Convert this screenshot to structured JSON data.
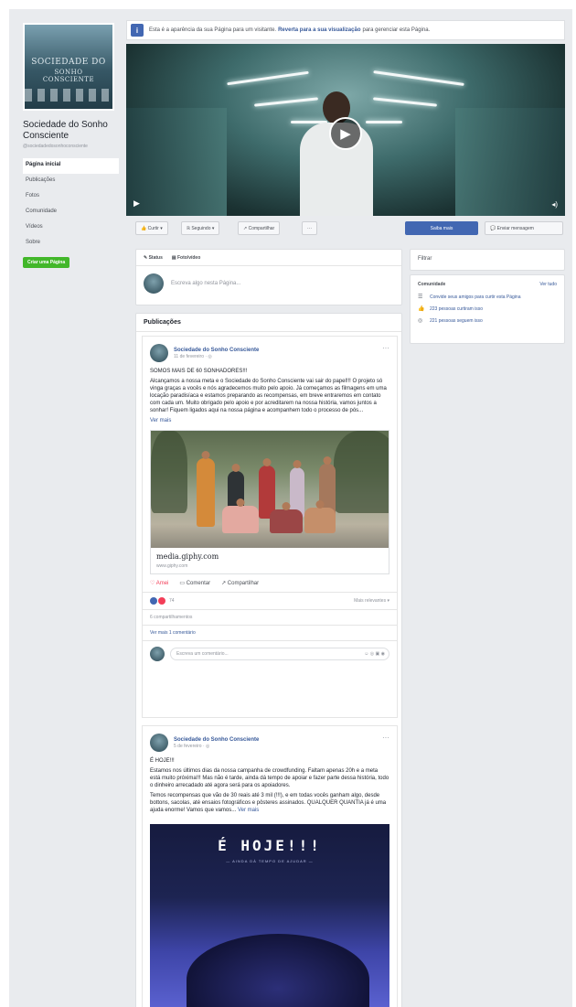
{
  "page": {
    "cover_line1": "SOCIEDADE DO",
    "cover_line2": "SONHO CONSCIENTE",
    "name": "Sociedade do Sonho Consciente",
    "username": "@sociedadedosonhoconsciente",
    "create_page": "Criar uma Página"
  },
  "nav": [
    {
      "label": "Página inicial",
      "active": true
    },
    {
      "label": "Publicações"
    },
    {
      "label": "Fotos"
    },
    {
      "label": "Comunidade"
    },
    {
      "label": "Vídeos"
    },
    {
      "label": "Sobre"
    }
  ],
  "banner": {
    "icon": "i",
    "text_before": "Esta é a aparência da sua Página para um visitante.",
    "link": "Reverta para a sua visualização",
    "text_after": "para gerenciar esta Página."
  },
  "actions": {
    "like": "👍 Curtir ▾",
    "follow": "ℝ Seguindo ▾",
    "share": "↗ Compartilhar",
    "more": "···",
    "primary": "Saiba mais",
    "message": "💬 Enviar mensagem"
  },
  "composer": {
    "tab_status": "✎ Status",
    "tab_video": "▤ Foto/vídeo",
    "placeholder": "Escreva algo nesta Página..."
  },
  "feed": {
    "title": "Publicações",
    "post1": {
      "author": "Sociedade do Sonho Consciente",
      "date": "11 de fevereiro · ◎",
      "headline": "SOMOS MAIS DE 60 SONHADORES!!!",
      "body": "Alcançamos a nossa meta e o Sociedade do Sonho Consciente vai sair do papel!!! O projeto só vinga graças a vocês e nós agradecemos muito pelo apoio. Já começamos as filmagens em uma locação paradisíaca e estamos preparando as recompensas, em breve entraremos em contato com cada um. Muito obrigado pelo apoio e por acreditarem na nossa história, vamos juntos a sonhar! Fiquem ligados aqui na nossa página e acompanhem todo o processo de pós...",
      "see_more": "Ver mais",
      "link_domain": "media.giphy.com",
      "link_sub": "www.giphy.com",
      "react_like": "♡ Amei",
      "react_comment": "▭ Comentar",
      "react_share": "↗ Compartilhar",
      "reaction_count": "74",
      "order": "Mais relevantes ▾",
      "shares": "6 compartilhamentos",
      "view_comments": "Ver mais 1 comentário",
      "comment_placeholder": "Escreva um comentário...",
      "comment_icons": "☺ ◎ ▣ ◉"
    },
    "post2": {
      "author": "Sociedade do Sonho Consciente",
      "date": "5 de fevereiro · ◎",
      "headline": "É HOJE!!!",
      "body1": "Estamos nos últimos dias da nossa campanha de crowdfunding. Faltam apenas 20h e a meta está muito próxima!!! Mas não é tarde, ainda dá tempo de apoiar e fazer parte dessa história, todo o dinheiro arrecadado até agora será para os apoiadores.",
      "body2": "Temos recompensas que vão de 30 reais até 3 mil (!!!), e em todas vocês ganham algo, desde bottons, sacolas, até ensaios fotográficos e pôsteres assinados. QUALQUER QUANTIA já é uma ajuda enorme! Vamos que vamos...",
      "see_more": "Ver mais",
      "image_title": "É HOJE!!!",
      "image_sub": "— AINDA DÁ TEMPO DE AJUDAR —"
    }
  },
  "right": {
    "filter": "Filtrar",
    "community_title": "Comunidade",
    "see_all": "Ver tudo",
    "rows": [
      {
        "icon": "☰",
        "text": "Convide seus amigos para curtir esta Página"
      },
      {
        "icon": "👍",
        "text": "223 pessoas curtiram isso"
      },
      {
        "icon": "◎",
        "text": "221 pessoas seguem isso"
      }
    ]
  },
  "colors": {
    "brand": "#4267b2",
    "link": "#365899",
    "create": "#42b72a",
    "background": "#e9ebee"
  }
}
